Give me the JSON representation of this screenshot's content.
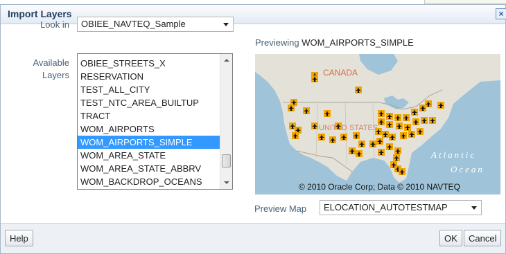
{
  "dialog": {
    "title": "Import Layers",
    "close_glyph": "×"
  },
  "look_in": {
    "label": "Look in",
    "value": "OBIEE_NAVTEQ_Sample"
  },
  "available_layers": {
    "label_line1": "Available",
    "label_line2": "Layers",
    "items": [
      "OBIEE_STREETS_X",
      "RESERVATION",
      "TEST_ALL_CITY",
      "TEST_NTC_AREA_BUILTUP",
      "TRACT",
      "WOM_AIRPORTS",
      "WOM_AIRPORTS_SIMPLE",
      "WOM_AREA_STATE",
      "WOM_AREA_STATE_ABBRV",
      "WOM_BACKDROP_OCEANS"
    ],
    "selected": "WOM_AIRPORTS_SIMPLE"
  },
  "preview": {
    "prefix": "Previewing",
    "layer": "WOM_AIRPORTS_SIMPLE",
    "map_labels": {
      "canada": "CANADA",
      "united_states": "UNITED STATES",
      "atlantic": "Atlantic",
      "ocean": "Ocean"
    },
    "copyright": "© 2010 Oracle Corp; Data © 2010 NAVTEQ",
    "marker_icon": "airport-icon",
    "colors": {
      "land": "#e4e2d8",
      "water": "#9fc3d8",
      "marker": "#f2a400"
    }
  },
  "preview_map": {
    "label": "Preview Map",
    "value": "ELOCATION_AUTOTESTMAP"
  },
  "buttons": {
    "help": "Help",
    "ok": "OK",
    "cancel": "Cancel"
  }
}
